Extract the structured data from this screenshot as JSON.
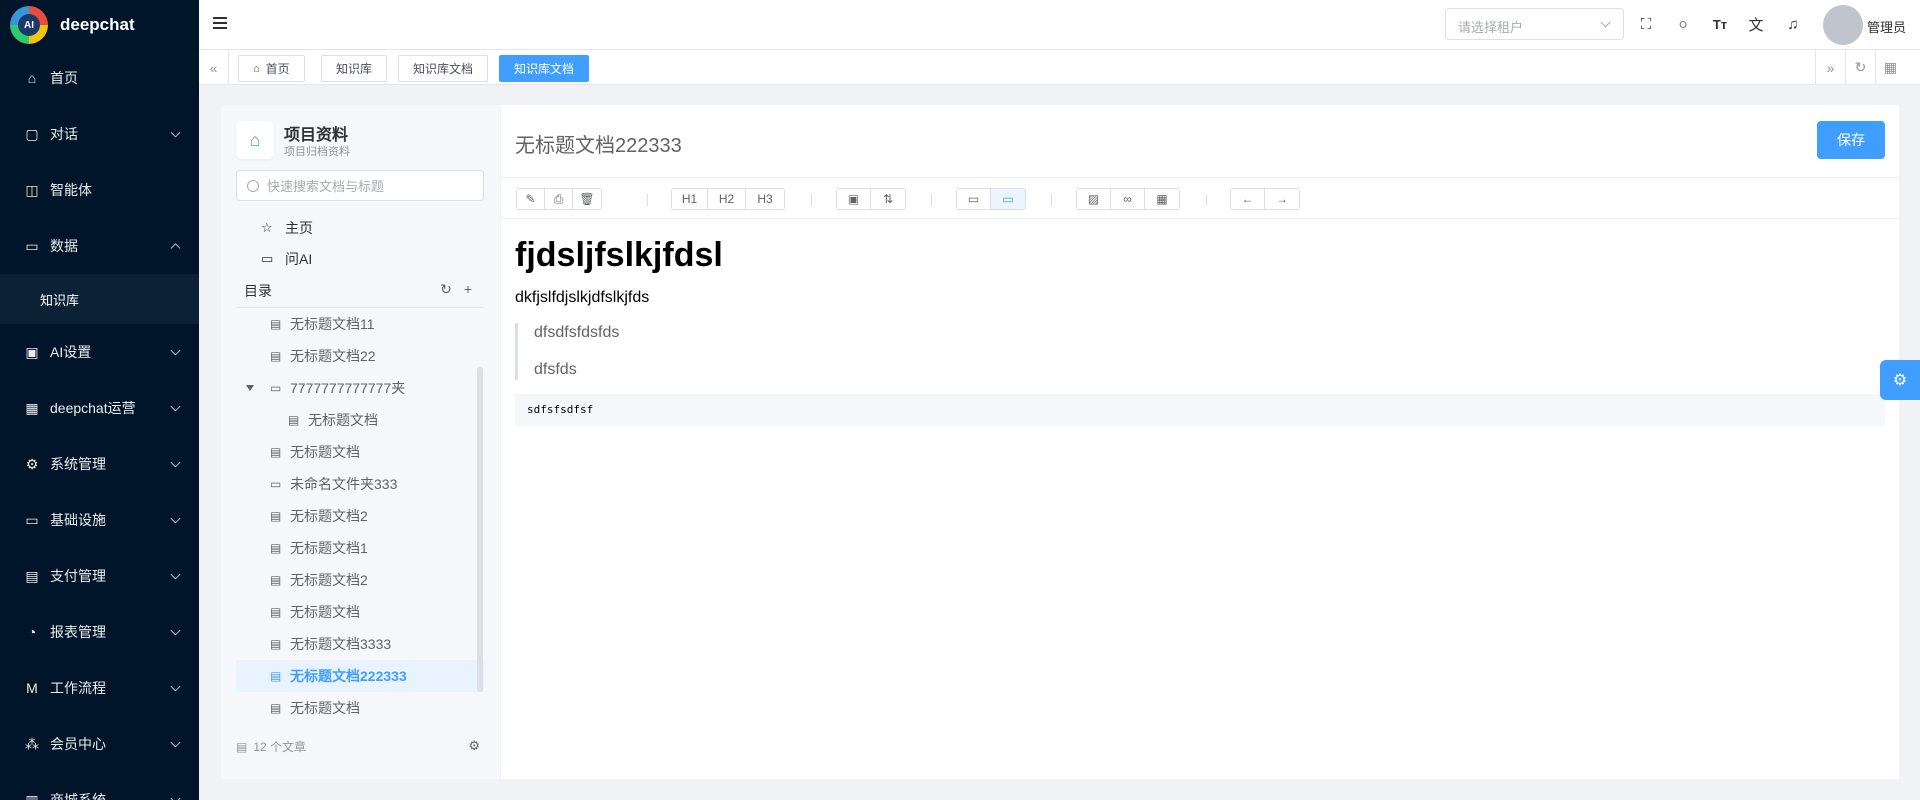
{
  "app": {
    "name": "deepchat",
    "logo_text": "AI"
  },
  "sidebar": {
    "items": [
      {
        "label": "首页",
        "icon": "home-icon"
      },
      {
        "label": "对话",
        "icon": "chat-icon"
      },
      {
        "label": "智能体",
        "icon": "chip-icon"
      },
      {
        "label": "数据",
        "icon": "folder-icon"
      },
      {
        "label": "知识库"
      },
      {
        "label": "AI设置",
        "icon": "ai-icon"
      },
      {
        "label": "deepchat运营",
        "icon": "grid-icon"
      },
      {
        "label": "系统管理",
        "icon": "gear-icon"
      },
      {
        "label": "基础设施",
        "icon": "monitor-icon"
      },
      {
        "label": "支付管理",
        "icon": "wallet-icon"
      },
      {
        "label": "报表管理",
        "icon": "pie-chart-icon"
      },
      {
        "label": "工作流程",
        "icon": "workflow-icon"
      },
      {
        "label": "会员中心",
        "icon": "people-icon"
      },
      {
        "label": "商城系统",
        "icon": "store-icon"
      }
    ]
  },
  "header": {
    "tenant_placeholder": "请选择租户",
    "font_icon_text": "Tт",
    "user_name": "管理员"
  },
  "tabs": [
    {
      "label": "首页"
    },
    {
      "label": "知识库"
    },
    {
      "label": "知识库文档"
    },
    {
      "label": "知识库文档"
    }
  ],
  "knowledge": {
    "title": "项目资料",
    "subtitle": "项目归档资料",
    "search_placeholder": "快速搜索文档与标题",
    "links": [
      "主页",
      "问AI"
    ],
    "toc_label": "目录",
    "tree": [
      {
        "label": "无标题文档11",
        "type": "doc"
      },
      {
        "label": "无标题文档22",
        "type": "doc"
      },
      {
        "label": "7777777777777夹",
        "type": "folder"
      },
      {
        "label": "无标题文档",
        "type": "doc"
      },
      {
        "label": "无标题文档",
        "type": "doc"
      },
      {
        "label": "未命名文件夹333",
        "type": "folder"
      },
      {
        "label": "无标题文档2",
        "type": "doc"
      },
      {
        "label": "无标题文档1",
        "type": "doc"
      },
      {
        "label": "无标题文档2",
        "type": "doc"
      },
      {
        "label": "无标题文档",
        "type": "doc"
      },
      {
        "label": "无标题文档3333",
        "type": "doc"
      },
      {
        "label": "无标题文档222333",
        "type": "doc"
      },
      {
        "label": "无标题文档",
        "type": "doc"
      }
    ],
    "footer_count": "12 个文章"
  },
  "editor": {
    "doc_title": "无标题文档222333",
    "save_label": "保存",
    "toolbar": {
      "h1": "H1",
      "h2": "H2",
      "h3": "H3"
    },
    "heading": "fjdsljfslkjfdsl",
    "paragraph": "dkfjslfdjslkjdfslkjfds",
    "quote_lines": [
      "dfsdfsfdsfds",
      "dfsfds"
    ],
    "code": "sdfsfsdfsf"
  },
  "colors": {
    "sidebar_bg": "#001529",
    "accent": "#409eff"
  }
}
